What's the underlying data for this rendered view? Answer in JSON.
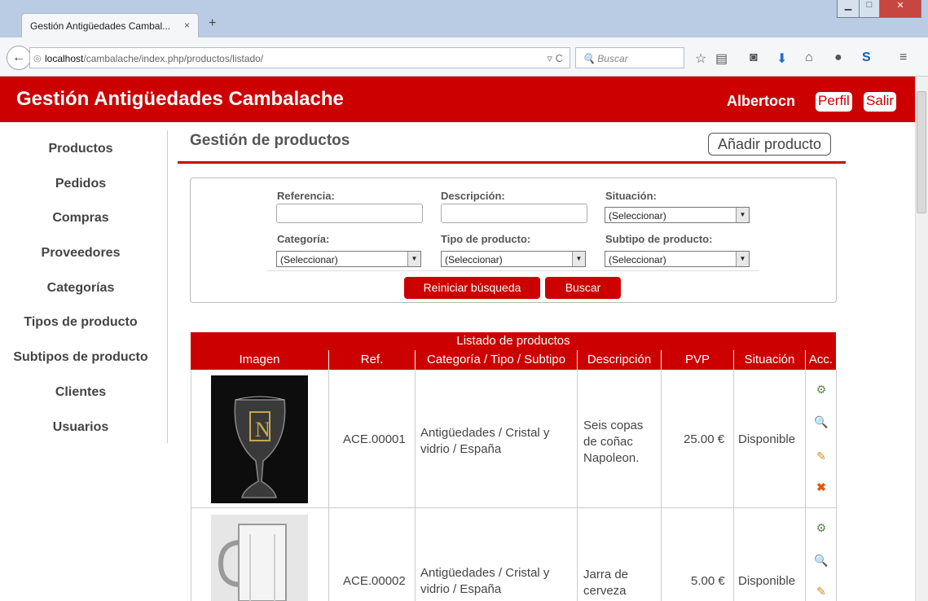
{
  "browser": {
    "tab_title": "Gestión Antigüedades Cambal...",
    "tab_close": "×",
    "new_tab": "+",
    "url_host": "localhost",
    "url_path": "/cambalache/index.php/productos/listado/",
    "search_placeholder": "Buscar"
  },
  "header": {
    "title": "Gestión Antigüedades Cambalache",
    "user": "Albertocn",
    "profile_label": "Perfil",
    "logout_label": "Salir"
  },
  "sidebar": {
    "items": [
      "Productos",
      "Pedidos",
      "Compras",
      "Proveedores",
      "Categorías",
      "Tipos de producto",
      "Subtipos de producto",
      "Clientes",
      "Usuarios"
    ]
  },
  "main": {
    "title": "Gestión de productos",
    "add_button": "Añadir producto"
  },
  "filters": {
    "referencia_label": "Referencia:",
    "descripcion_label": "Descripción:",
    "situacion_label": "Situación:",
    "situacion_value": "(Seleccionar)",
    "categoria_label": "Categoría:",
    "categoria_value": "(Seleccionar)",
    "tipo_label": "Tipo de producto:",
    "tipo_value": "(Seleccionar)",
    "subtipo_label": "Subtipo de producto:",
    "subtipo_value": "(Seleccionar)",
    "reset_button": "Reiniciar búsqueda",
    "search_button": "Buscar"
  },
  "table": {
    "caption": "Listado de productos",
    "headers": [
      "Imagen",
      "Ref.",
      "Categoría / Tipo / Subtipo",
      "Descripción",
      "PVP",
      "Situación",
      "Acc."
    ],
    "rows": [
      {
        "ref": "ACE.00001",
        "cat1": "Antigüedades / Cristal y",
        "cat2": "vidrio / España",
        "desc1": "Seis copas",
        "desc2": "de coñac",
        "desc3": "Napoleon.",
        "pvp": "25.00 €",
        "situacion": "Disponible"
      },
      {
        "ref": "ACE.00002",
        "cat1": "Antigüedades / Cristal y",
        "cat2": "vidrio / España",
        "desc1": "Jarra de",
        "desc2": "cerveza",
        "desc3": "",
        "pvp": "5.00 €",
        "situacion": "Disponible"
      }
    ]
  }
}
